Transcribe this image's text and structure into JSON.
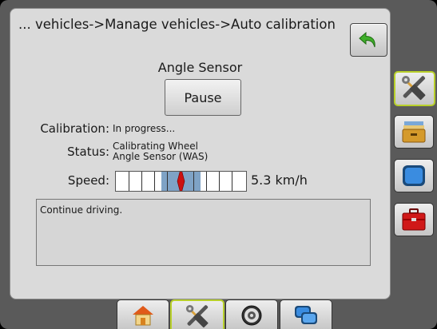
{
  "header": {
    "breadcrumb": "... vehicles->Manage vehicles->Auto calibration"
  },
  "calibration": {
    "sensor_title": "Angle Sensor",
    "pause_label": "Pause",
    "calibration_label": "Calibration:",
    "calibration_value": "In progress...",
    "status_label": "Status:",
    "status_line1": "Calibrating Wheel",
    "status_line2": "Angle Sensor (WAS)",
    "speed_label": "Speed:",
    "speed_value": "5.3 km/h",
    "speed_fill_fraction": 0.3
  },
  "message": {
    "text": "Continue driving."
  },
  "sidebar": {
    "items": [
      {
        "icon": "tools-icon",
        "active": true
      },
      {
        "icon": "file-drawer-icon",
        "active": false
      },
      {
        "icon": "monitor-icon",
        "active": false
      },
      {
        "icon": "toolbox-icon",
        "active": false
      }
    ]
  },
  "bottom_tabs": [
    {
      "icon": "home-icon",
      "active": false
    },
    {
      "icon": "tools-icon",
      "active": true
    },
    {
      "icon": "gauge-icon",
      "active": false
    },
    {
      "icon": "screens-icon",
      "active": false
    }
  ],
  "colors": {
    "accent": "#b8d02a",
    "fill": "#7fa3c6",
    "needle": "#cc1111"
  }
}
